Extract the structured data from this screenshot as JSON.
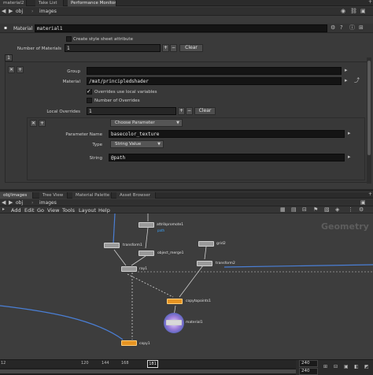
{
  "top_tabs": [
    "material2",
    "Take List",
    "Performance Monitor"
  ],
  "top_path": {
    "context": "obj",
    "node": "images"
  },
  "param_header": {
    "type_label": "Material",
    "node_name": "material1"
  },
  "create_style_sheet_label": "Create style sheet attribute",
  "num_materials": {
    "label": "Number of Materials",
    "value": "1",
    "clear_label": "Clear"
  },
  "multiparm_tab": "1",
  "group": {
    "label": "Group",
    "value": ""
  },
  "material": {
    "label": "Material",
    "value": "/mat/principledshader"
  },
  "overrides_use_local": {
    "label": "Overrides use local variables",
    "checked": true
  },
  "num_overrides": {
    "label": "Number of Overrides",
    "checked": false
  },
  "local_overrides": {
    "label": "Local Overrides",
    "value": "1",
    "clear_label": "Clear"
  },
  "choose_param": {
    "label": "Choose Parameter"
  },
  "param_name": {
    "label": "Parameter Name",
    "value": "basecolor_texture"
  },
  "type": {
    "label": "Type",
    "value": "String Value"
  },
  "string": {
    "label": "String",
    "value": "@path"
  },
  "bottom_tabs": [
    "obj/images",
    "Tree View",
    "Material Palette",
    "Asset Browser"
  ],
  "bottom_path": {
    "context": "obj",
    "node": "images"
  },
  "menubar": [
    "Add",
    "Edit",
    "Go",
    "View",
    "Tools",
    "Layout",
    "Help"
  ],
  "network_watermark": "Geometry",
  "nodes": [
    {
      "name": "attribpromote1",
      "sub": "path"
    },
    {
      "name": "grid2"
    },
    {
      "name": "transform1"
    },
    {
      "name": "object_merge1"
    },
    {
      "name": "transform2"
    },
    {
      "name": "ray1"
    },
    {
      "name": "copytopoints1"
    },
    {
      "name": "material1"
    },
    {
      "name": "copy1"
    }
  ],
  "timeline": {
    "ticks": [
      "12",
      "120",
      "144",
      "168",
      "181"
    ],
    "end_frames": [
      "240",
      "240"
    ]
  },
  "colors": {
    "node_flag_orange": "#e69422",
    "wire_blue": "#4a7fd6",
    "accent_blue": "#3ba6ff"
  }
}
